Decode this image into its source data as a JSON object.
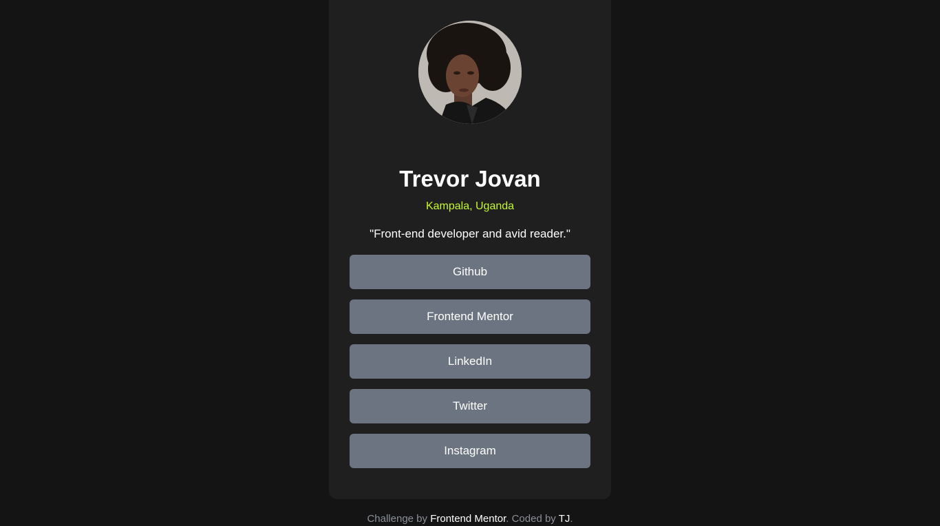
{
  "profile": {
    "name": "Trevor Jovan",
    "location": "Kampala, Uganda",
    "bio": "\"Front-end developer and avid reader.\"",
    "avatar_icon": "profile-photo"
  },
  "links": [
    {
      "label": "Github"
    },
    {
      "label": "Frontend Mentor"
    },
    {
      "label": "LinkedIn"
    },
    {
      "label": "Twitter"
    },
    {
      "label": "Instagram"
    }
  ],
  "footer": {
    "prefix": "Challenge by",
    "challenge_link": "Frontend Mentor",
    "middle": ". Coded by",
    "author_link": "TJ",
    "suffix": "."
  },
  "colors": {
    "background": "#141414",
    "card": "#1f1f1f",
    "accent": "#c4f82a",
    "button": "#6d7481"
  }
}
